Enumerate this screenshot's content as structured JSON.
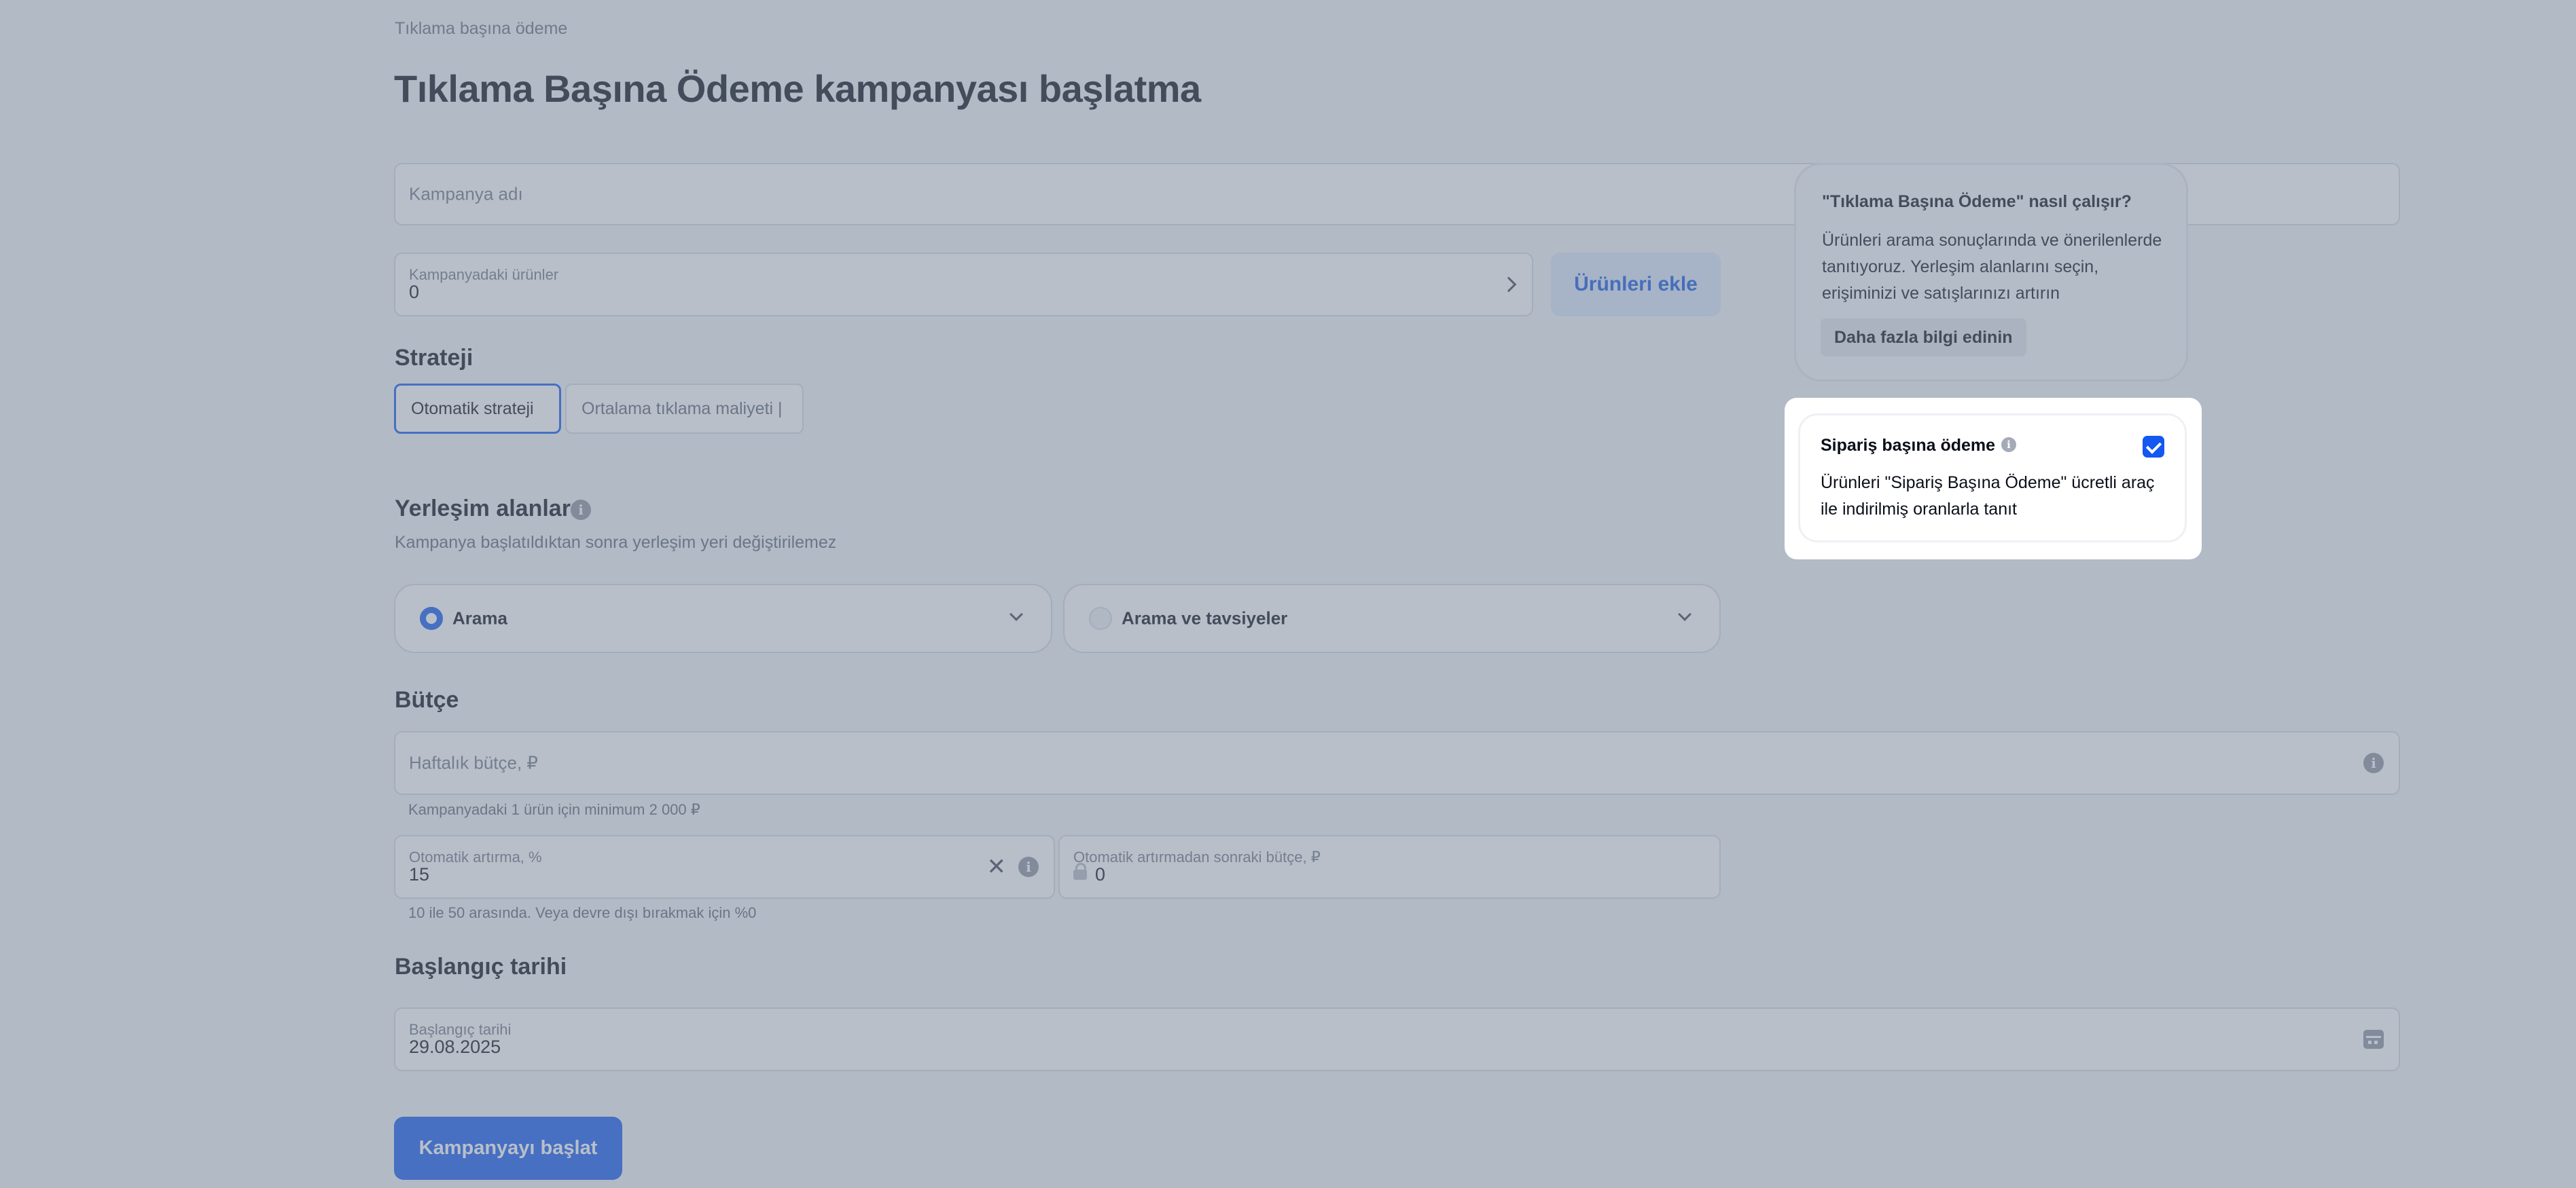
{
  "breadcrumb": "Tıklama başına ödeme",
  "page_title": "Tıklama Başına Ödeme kampanyası başlatma",
  "campaign_name": {
    "placeholder": "Kampanya adı",
    "value": ""
  },
  "products": {
    "label": "Kampanyadaki ürünler",
    "value": "0",
    "add_button": "Ürünleri ekle"
  },
  "strategy": {
    "title": "Strateji",
    "options": [
      {
        "label": "Otomatik strateji",
        "selected": true
      },
      {
        "label": "Ortalama tıklama maliyeti |",
        "selected": false
      }
    ]
  },
  "placements": {
    "title": "Yerleşim alanları",
    "subtitle": "Kampanya başlatıldıktan sonra yerleşim yeri değiştirilemez",
    "options": [
      {
        "label": "Arama",
        "selected": true
      },
      {
        "label": "Arama ve tavsiyeler",
        "selected": false
      }
    ]
  },
  "budget": {
    "title": "Bütçe",
    "weekly_placeholder": "Haftalık bütçe, ₽",
    "weekly_hint": "Kampanyadaki 1 ürün için minimum 2 000 ₽",
    "auto_increase_label": "Otomatik artırma, %",
    "auto_increase_value": "15",
    "after_budget_label": "Otomatik artırmadan sonraki bütçe, ₽",
    "after_budget_value": "0",
    "auto_increase_hint": "10 ile 50 arasında. Veya devre dışı bırakmak için %0"
  },
  "start_date": {
    "title": "Başlangıç tarihi",
    "label": "Başlangıç tarihi",
    "value": "29.08.2025"
  },
  "submit_button": "Kampanyayı başlat",
  "help_card": {
    "title": "\"Tıklama Başına Ödeme\" nasıl çalışır?",
    "body": "Ürünleri arama sonuçlarında ve önerilenlerde tanıtıyoruz. Yerleşim alanlarını seçin, erişiminizi ve satışlarınızı artırın",
    "button": "Daha fazla bilgi edinin"
  },
  "ppo_card": {
    "title": "Sipariş başına ödeme",
    "checked": true,
    "body": "Ürünleri \"Sipariş Başına Ödeme\" ücretli araç ile indirilmiş oranlarla tanıt"
  },
  "colors": {
    "accent": "#1358f0",
    "overlay": "#768497"
  },
  "icons": [
    "chevron-right-icon",
    "info-icon",
    "chevron-down-icon",
    "close-icon",
    "lock-icon",
    "calendar-icon",
    "check-icon"
  ]
}
